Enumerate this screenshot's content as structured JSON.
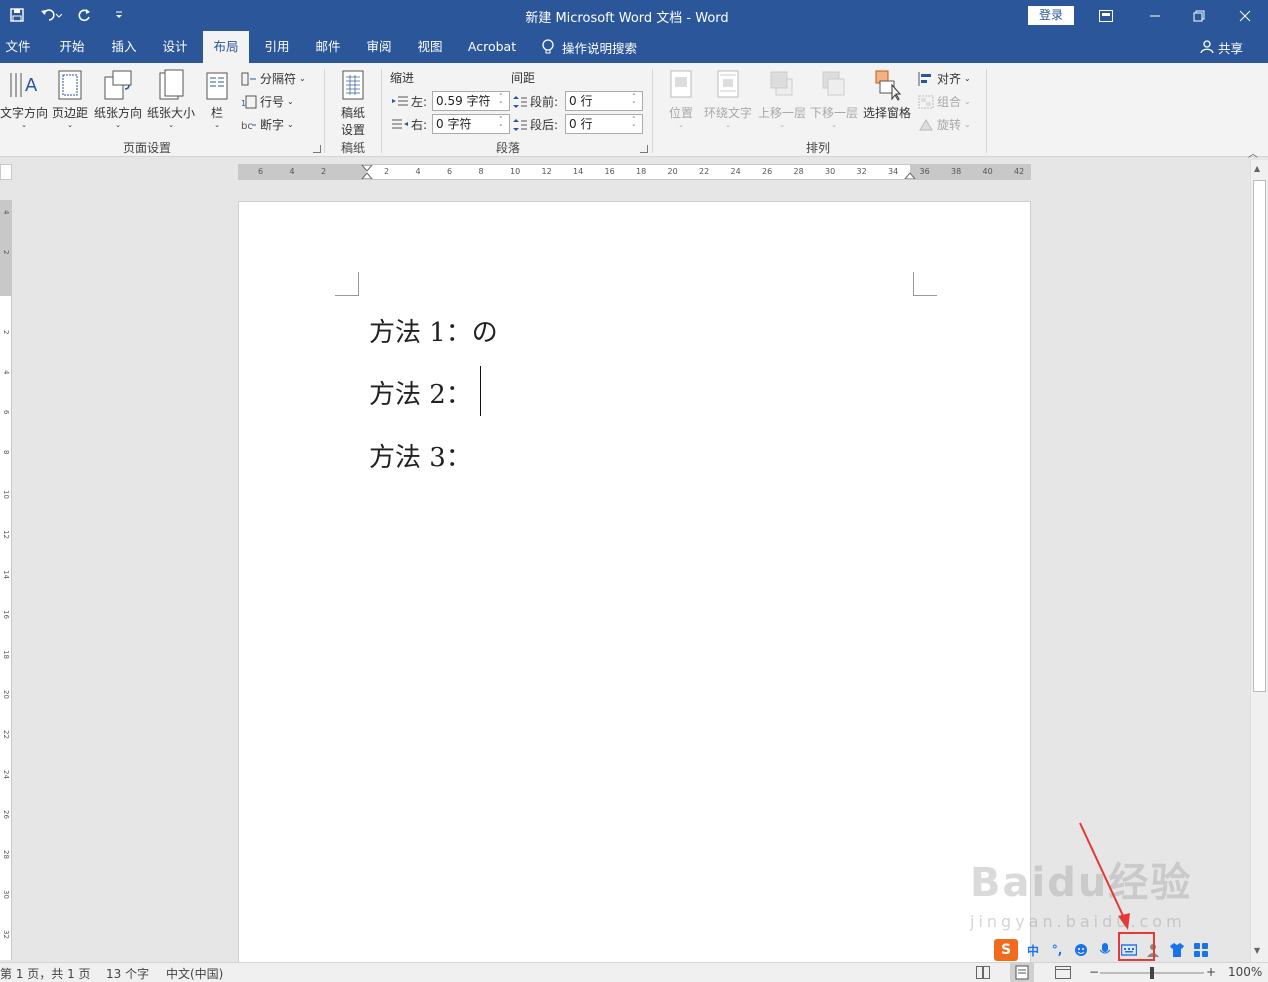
{
  "window": {
    "title": "新建 Microsoft Word 文档  -  Word",
    "login": "登录"
  },
  "tabs": [
    "文件",
    "开始",
    "插入",
    "设计",
    "布局",
    "引用",
    "邮件",
    "审阅",
    "视图",
    "Acrobat"
  ],
  "active_tab": "布局",
  "tell_me": "操作说明搜索",
  "share": "共享",
  "ribbon": {
    "page_setup": {
      "text_direction": "文字方向",
      "margins": "页边距",
      "orientation": "纸张方向",
      "size": "纸张大小",
      "columns": "栏",
      "breaks": "分隔符",
      "line_numbers": "行号",
      "hyphenation": "断字",
      "label": "页面设置"
    },
    "manuscript": {
      "setup_line1": "稿纸",
      "setup_line2": "设置",
      "label": "稿纸"
    },
    "paragraph": {
      "indent_label": "缩进",
      "spacing_label": "间距",
      "left_label": "左:",
      "left_value": "0.59 字符",
      "right_label": "右:",
      "right_value": "0 字符",
      "before_label": "段前:",
      "before_value": "0 行",
      "after_label": "段后:",
      "after_value": "0 行",
      "label": "段落"
    },
    "arrange": {
      "position": "位置",
      "wrap_text": "环绕文字",
      "bring_forward": "上移一层",
      "send_backward": "下移一层",
      "selection_pane": "选择窗格",
      "align": "对齐",
      "group": "组合",
      "rotate": "旋转",
      "label": "排列"
    }
  },
  "ruler": {
    "h_ticks": [
      "6",
      "4",
      "2",
      "",
      "2",
      "4",
      "6",
      "8",
      "10",
      "12",
      "14",
      "16",
      "18",
      "20",
      "22",
      "24",
      "26",
      "28",
      "30",
      "32",
      "34",
      "36",
      "38",
      "40",
      "42"
    ],
    "v_ticks": [
      "4",
      "2",
      "",
      "2",
      "4",
      "6",
      "8",
      "10",
      "12",
      "14",
      "16",
      "18",
      "20",
      "22",
      "24",
      "26",
      "28",
      "30",
      "32"
    ]
  },
  "document": {
    "lines": [
      "方法 1：の",
      "方法 2：",
      "方法 3："
    ]
  },
  "status": {
    "page": "第 1 页，共 1 页",
    "words": "13 个字",
    "language": "中文(中国)",
    "zoom": "100%"
  },
  "ime": {
    "lang": "中",
    "punct": "°,"
  },
  "watermark": {
    "brand": "Baidu经验",
    "url": "jingyan.baidu.com"
  },
  "colors": {
    "title_bar": "#2b579a",
    "highlight": "#e53935"
  }
}
